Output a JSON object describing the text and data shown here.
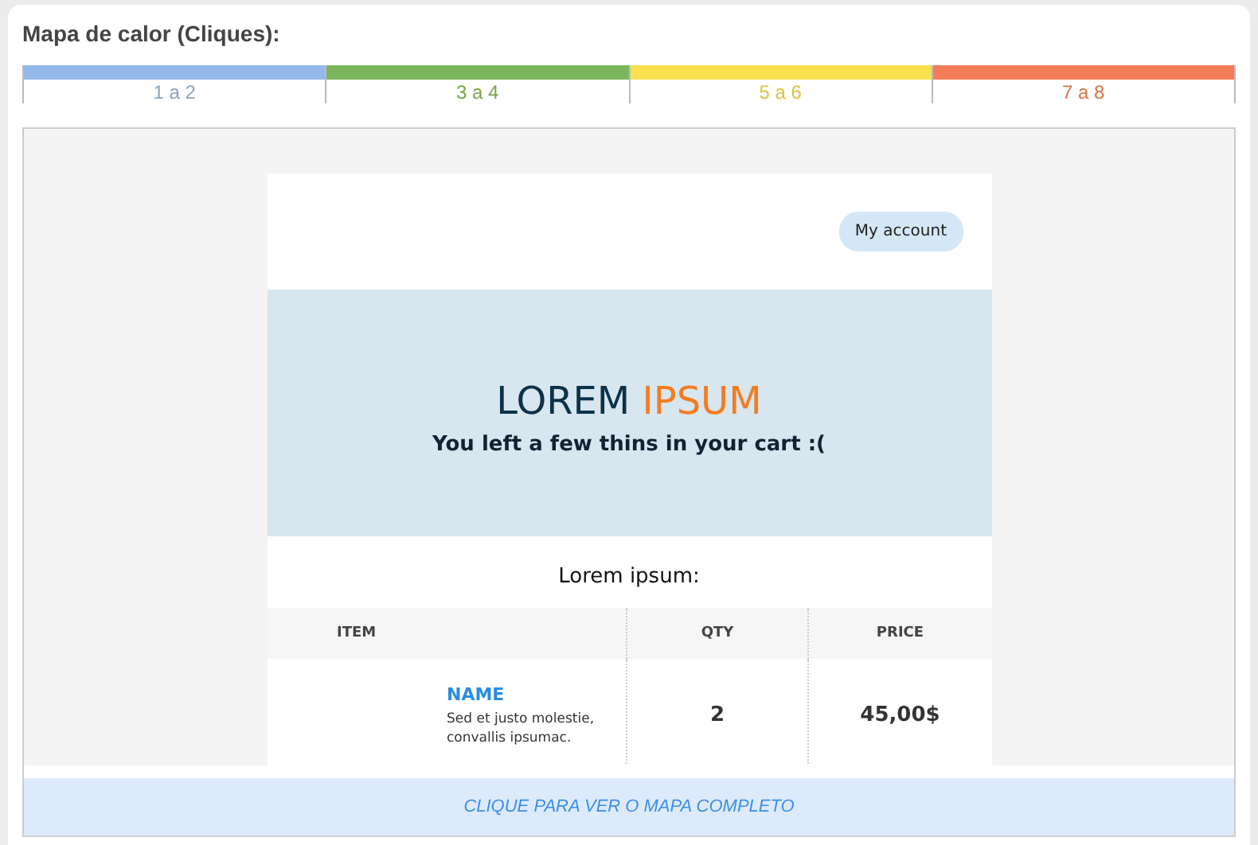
{
  "heading": "Mapa de calor (Cliques):",
  "legend": [
    {
      "label": "1 a 2",
      "color": "#94b8ea"
    },
    {
      "label": "3 a 4",
      "color": "#7cb65c"
    },
    {
      "label": "5 a 6",
      "color": "#f8e04e"
    },
    {
      "label": "7 a 8",
      "color": "#f47c58"
    }
  ],
  "email": {
    "account_button": "My account",
    "brand_first": "LOREM",
    "brand_second": "IPSUM",
    "subtitle": "You left a few thins in your cart :(",
    "section_title": "Lorem ipsum:",
    "table": {
      "columns": [
        "ITEM",
        "QTY",
        "PRICE"
      ],
      "rows": [
        {
          "name": "NAME",
          "description": "Sed et justo molestie, convallis ipsumac.",
          "qty": "2",
          "price": "45,00$"
        }
      ]
    }
  },
  "footer_link": "CLIQUE PARA VER O MAPA COMPLETO"
}
